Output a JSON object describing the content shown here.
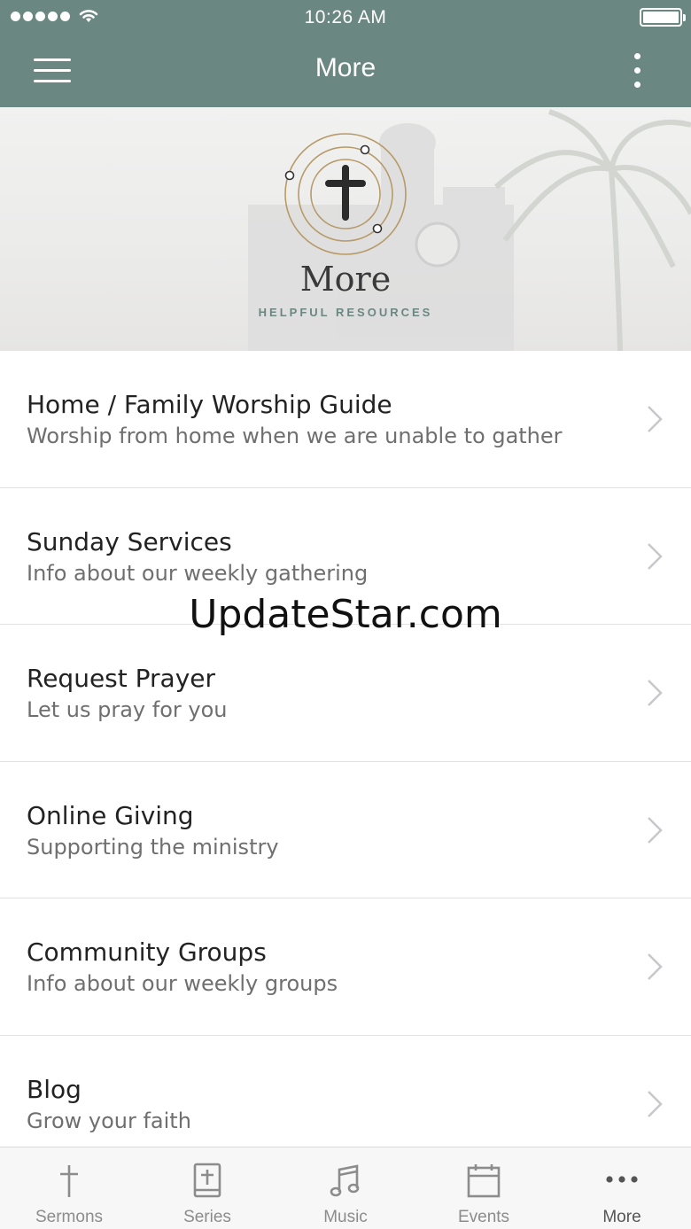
{
  "status_bar": {
    "time": "10:26 AM"
  },
  "nav": {
    "title": "More"
  },
  "banner": {
    "title": "More",
    "subtitle": "HELPFUL RESOURCES"
  },
  "list": [
    {
      "title": "Home / Family Worship Guide",
      "subtitle": "Worship from home when we are unable to gather"
    },
    {
      "title": "Sunday Services",
      "subtitle": "Info about our weekly gathering"
    },
    {
      "title": "Request Prayer",
      "subtitle": "Let us pray for you"
    },
    {
      "title": "Online Giving",
      "subtitle": "Supporting the ministry"
    },
    {
      "title": "Community Groups",
      "subtitle": "Info about our weekly groups"
    },
    {
      "title": "Blog",
      "subtitle": "Grow your faith"
    }
  ],
  "watermark": "UpdateStar.com",
  "tabs": [
    {
      "label": "Sermons",
      "icon": "cross-icon"
    },
    {
      "label": "Series",
      "icon": "bible-icon"
    },
    {
      "label": "Music",
      "icon": "music-note-icon"
    },
    {
      "label": "Events",
      "icon": "calendar-icon"
    },
    {
      "label": "More",
      "icon": "more-dots-icon",
      "active": true
    }
  ],
  "colors": {
    "header": "#6b8781",
    "accent": "#6b8781"
  }
}
